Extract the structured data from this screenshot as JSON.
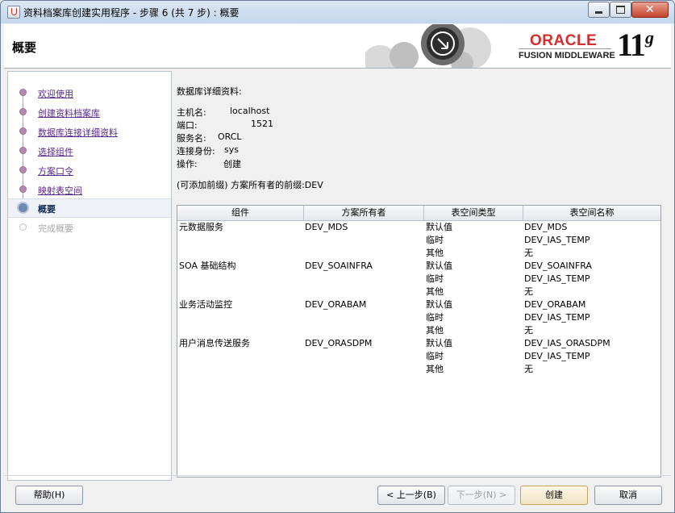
{
  "window": {
    "title": "资料档案库创建实用程序 - 步骤 6 (共 7 步) : 概要",
    "min_label": "",
    "close_label": "✕"
  },
  "header": {
    "title": "概要",
    "oracle": "ORACLE",
    "fusion": "FUSION MIDDLEWARE",
    "version": "11",
    "version_suffix": "g"
  },
  "nav": {
    "items": [
      {
        "label": "欢迎使用"
      },
      {
        "label": "创建资料档案库"
      },
      {
        "label": "数据库连接详细资料"
      },
      {
        "label": "选择组件"
      },
      {
        "label": "方案口令"
      },
      {
        "label": "映射表空间"
      },
      {
        "label": "概要"
      },
      {
        "label": "完成概要"
      }
    ]
  },
  "details": {
    "heading": "数据库详细资料:",
    "host_label": "主机名:",
    "host_value": "localhost",
    "port_label": "端口:",
    "port_value": "1521",
    "service_label": "服务名:",
    "service_value": "ORCL",
    "connect_label": "连接身份:",
    "connect_value": "sys",
    "operation_label": "操作:",
    "operation_value": "创建",
    "prefix_note": "(可添加前缀) 方案所有者的前缀:DEV"
  },
  "table": {
    "headers": [
      "组件",
      "方案所有者",
      "表空间类型",
      "表空间名称"
    ],
    "rows": [
      {
        "component": "元数据服务",
        "owner": "DEV_MDS",
        "types": [
          "默认值",
          "临时",
          "其他"
        ],
        "names": [
          "DEV_MDS",
          "DEV_IAS_TEMP",
          "无"
        ]
      },
      {
        "component": "SOA 基础结构",
        "owner": "DEV_SOAINFRA",
        "types": [
          "默认值",
          "临时",
          "其他"
        ],
        "names": [
          "DEV_SOAINFRA",
          "DEV_IAS_TEMP",
          "无"
        ]
      },
      {
        "component": "业务活动监控",
        "owner": "DEV_ORABAM",
        "types": [
          "默认值",
          "临时",
          "其他"
        ],
        "names": [
          "DEV_ORABAM",
          "DEV_IAS_TEMP",
          "无"
        ]
      },
      {
        "component": "用户消息传送服务",
        "owner": "DEV_ORASDPM",
        "types": [
          "默认值",
          "临时",
          "其他"
        ],
        "names": [
          "DEV_IAS_ORASDPM",
          "DEV_IAS_TEMP",
          "无"
        ]
      }
    ]
  },
  "buttons": {
    "help": "帮助(H)",
    "back": "< 上一步(B)",
    "next": "下一步(N) >",
    "create": "创建",
    "cancel": "取消"
  },
  "colors": {
    "link": "#5a2a87",
    "oracle_red": "#d32f2f",
    "active_nav": "#102a54"
  }
}
